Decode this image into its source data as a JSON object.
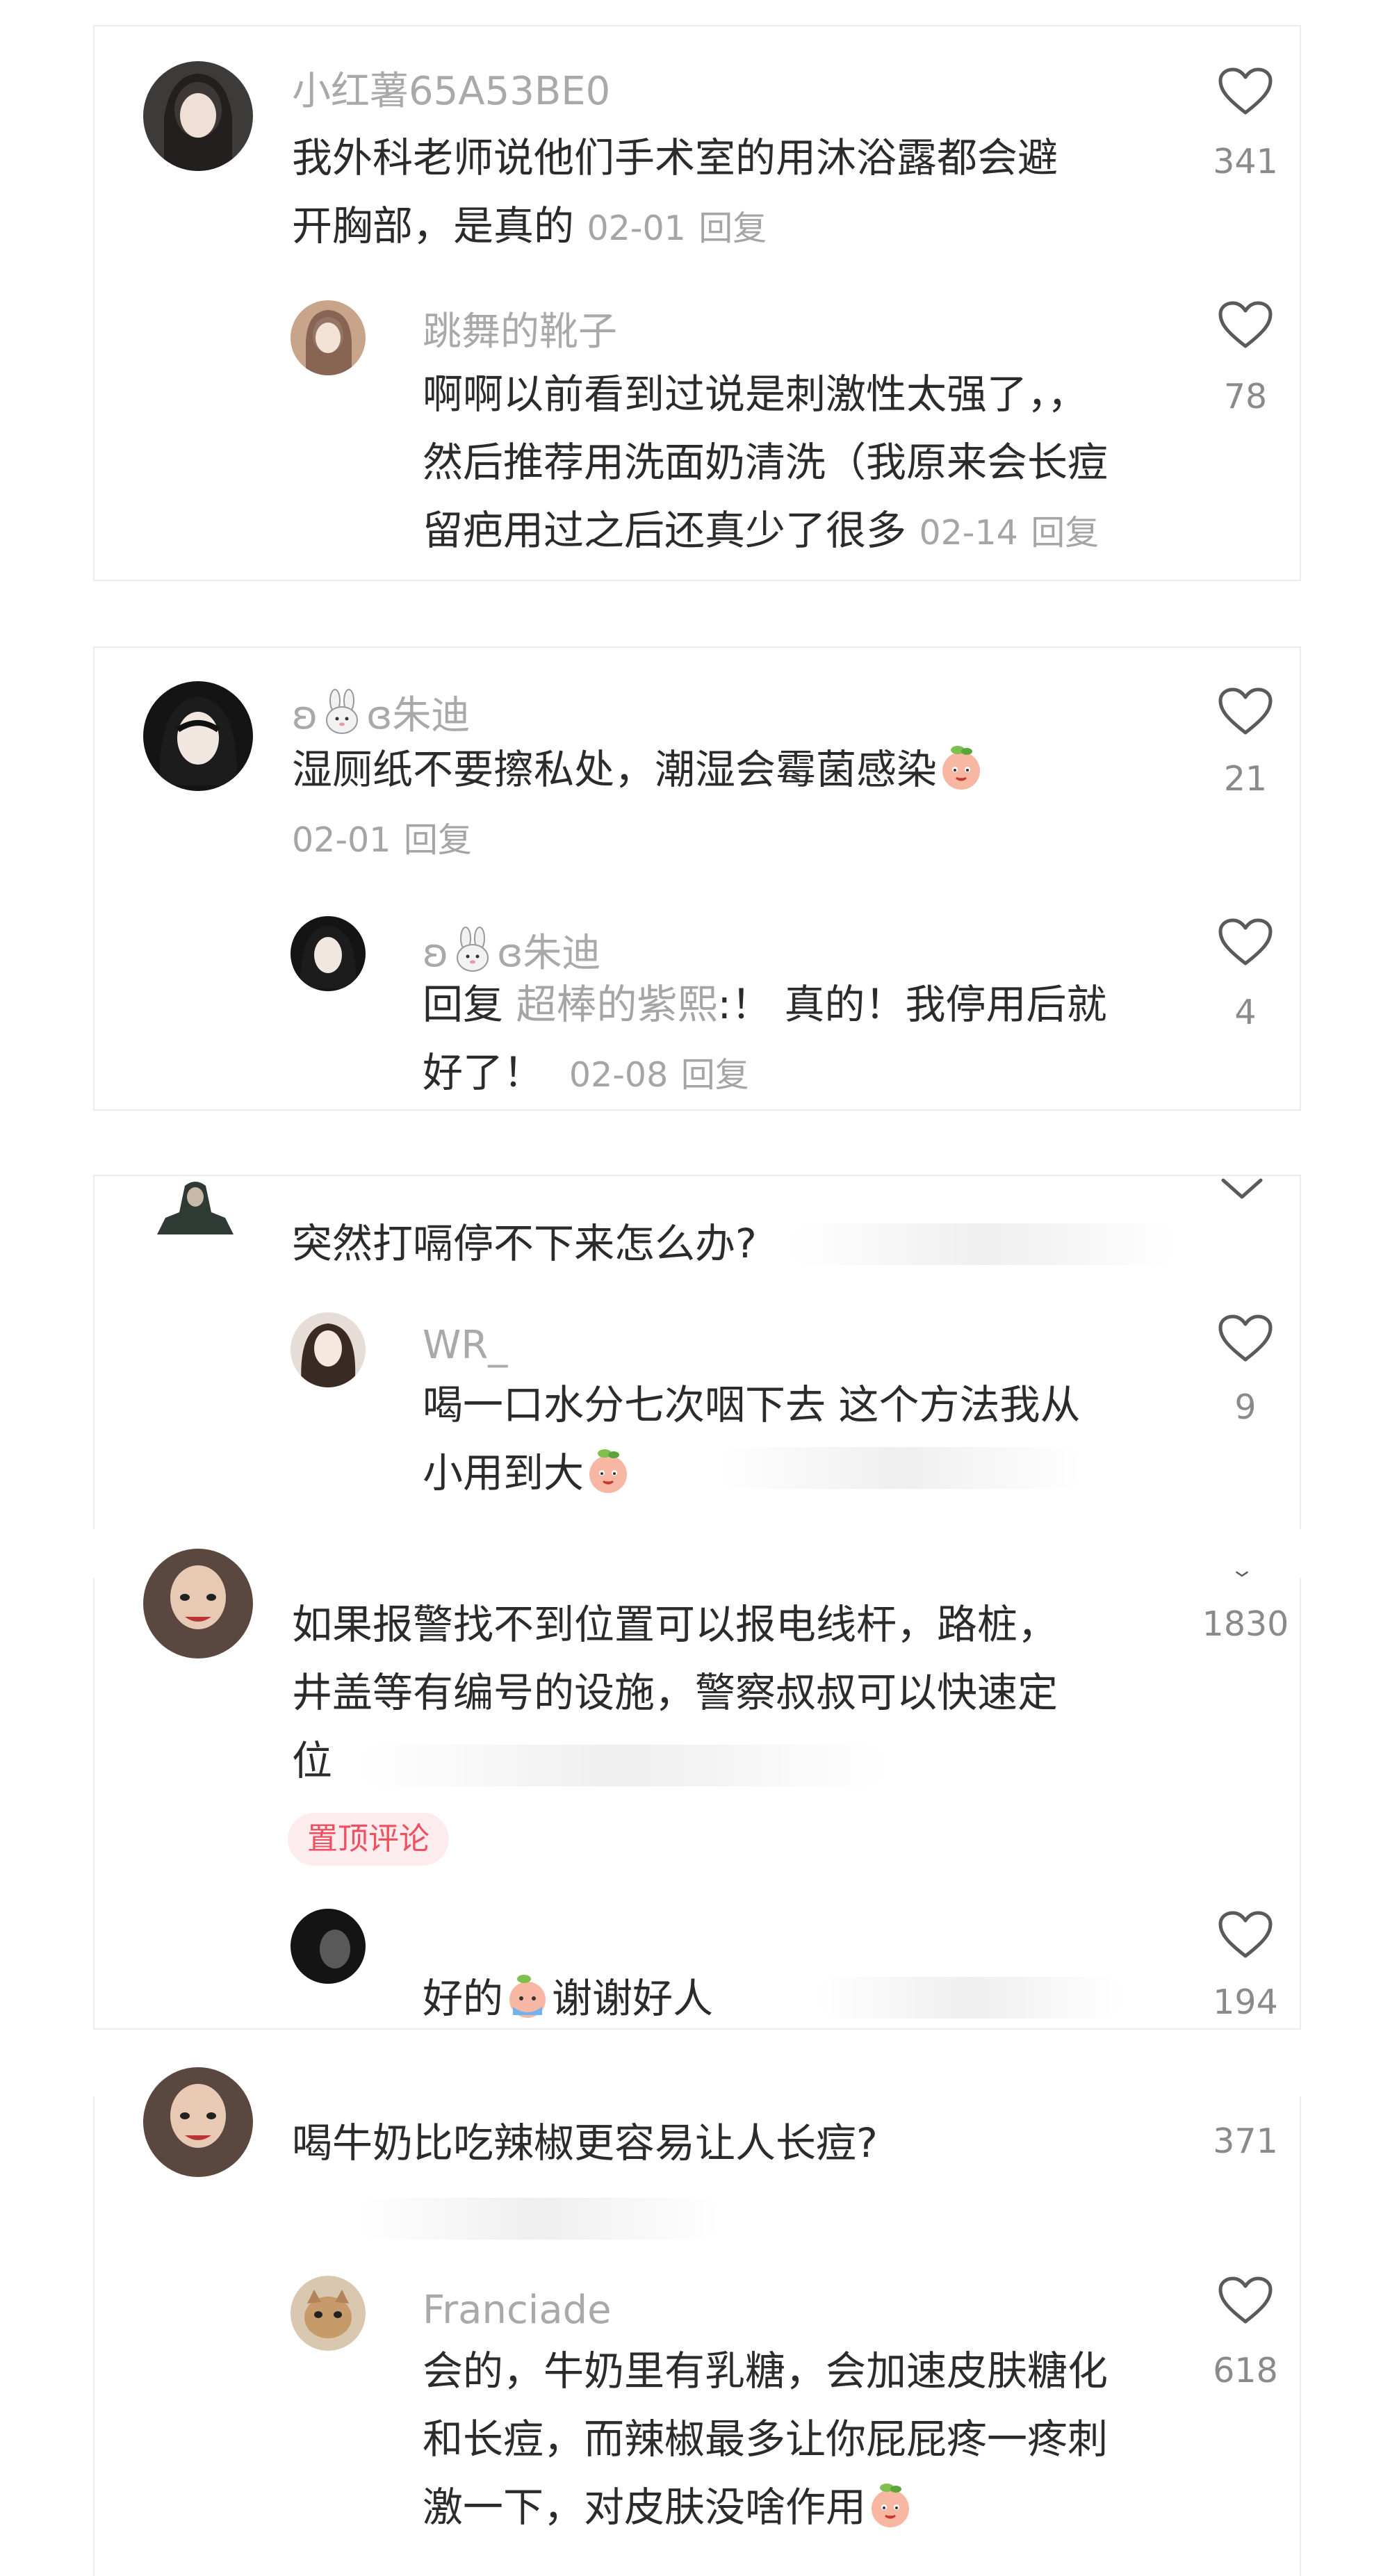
{
  "comments": [
    {
      "user": "小红薯65A53BE0",
      "text_lines": [
        "我外科老师说他们手术室的用沐浴露都会避",
        "开胸部，是真的"
      ],
      "date": "02-01",
      "reply_label": "回复",
      "likes": "341",
      "reply": {
        "user": "跳舞的靴子",
        "text_lines": [
          "啊啊以前看到过说是刺激性太强了，，",
          "然后推荐用洗面奶清洗（我原来会长痘",
          "留疤用过之后还真少了很多"
        ],
        "date": "02-14",
        "reply_label": "回复",
        "likes": "78"
      }
    },
    {
      "user_prefix": "ʚ",
      "user_suffix": "ɞ朱迪",
      "text_lines": [
        "湿厕纸不要擦私处，潮湿会霉菌感染"
      ],
      "date": "02-01",
      "reply_label": "回复",
      "likes": "21",
      "reply": {
        "user_prefix": "ʚ",
        "user_suffix": "ɞ朱迪",
        "reply_prefix": "回复",
        "mention": "超棒的紫熙",
        "text_after_mention": ":！ 真的！我停用后就",
        "text_line2": "好了！",
        "date": "02-08",
        "reply_label": "回复",
        "likes": "4"
      }
    },
    {
      "text_lines": [
        "突然打嗝停不下来怎么办?"
      ],
      "reply": {
        "user": "WR_",
        "text_lines": [
          "喝一口水分七次咽下去 这个方法我从",
          "小用到大"
        ],
        "likes": "9"
      }
    },
    {
      "text_lines": [
        "如果报警找不到位置可以报电线杆，路桩，",
        "井盖等有编号的设施，警察叔叔可以快速定",
        "位"
      ],
      "likes": "1830",
      "pin_label": "置顶评论",
      "reply": {
        "text_parts": [
          "好的",
          "谢谢好人"
        ],
        "likes": "194"
      }
    },
    {
      "text_lines": [
        "喝牛奶比吃辣椒更容易让人长痘?"
      ],
      "likes": "371",
      "reply": {
        "user": "Franciade",
        "text_lines": [
          "会的，牛奶里有乳糖，会加速皮肤糖化",
          "和长痘，而辣椒最多让你屁屁疼一疼刺",
          "激一下，对皮肤没啥作用"
        ],
        "likes": "618"
      }
    }
  ],
  "icons": {
    "heart": "heart-outline-icon",
    "chevron": "chevron-down-icon",
    "bunny": "bunny-emoji",
    "peach": "peach-emoji"
  },
  "colors": {
    "pin_bg": "#fdecee",
    "pin_text": "#ef4f5e",
    "meta_text": "#a5a5a5",
    "body_text": "#2b2b2b"
  }
}
